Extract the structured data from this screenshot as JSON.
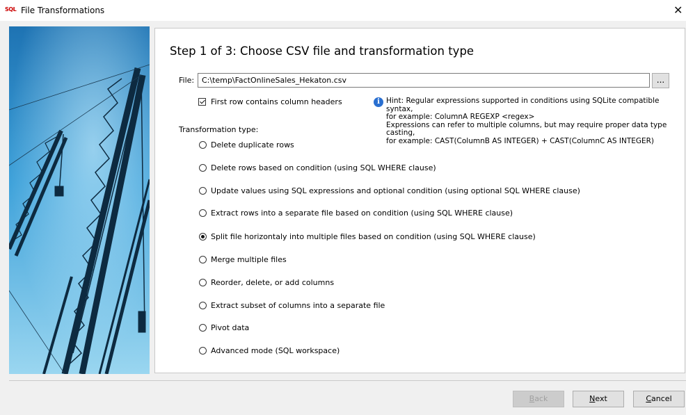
{
  "window": {
    "title": "File Transformations",
    "icon_text": "SQL",
    "close_glyph": "✕"
  },
  "step": {
    "title": "Step 1 of 3:  Choose CSV file and transformation type"
  },
  "file": {
    "label": "File:",
    "value": "C:\\temp\\FactOnlineSales_Hekaton.csv",
    "browse_label": "..."
  },
  "first_row_header": {
    "label": "First row contains column headers",
    "checked": true
  },
  "hint": {
    "line1": "Hint: Regular expressions supported in  conditions using SQLite compatible syntax,",
    "line2": "for example: ColumnA REGEXP <regex>",
    "line3": "Expressions can refer to multiple columns, but may require proper data type casting,",
    "line4": "for example: CAST(ColumnB AS INTEGER) + CAST(ColumnC AS INTEGER)"
  },
  "transformation": {
    "label": "Transformation type:",
    "options": [
      {
        "label": "Delete duplicate rows",
        "checked": false
      },
      {
        "label": "Delete rows based on condition (using SQL WHERE clause)",
        "checked": false
      },
      {
        "label": "Update values using SQL expressions and optional condition (using optional SQL WHERE clause)",
        "checked": false
      },
      {
        "label": "Extract rows into a separate file based on condition (using SQL WHERE clause)",
        "checked": false
      },
      {
        "label": "Split file horizontaly into multiple files based on condition (using SQL WHERE clause)",
        "checked": true
      },
      {
        "label": "Merge multiple files",
        "checked": false
      },
      {
        "label": "Reorder, delete, or add columns",
        "checked": false
      },
      {
        "label": "Extract subset of columns into a separate file",
        "checked": false
      },
      {
        "label": "Pivot data",
        "checked": false
      },
      {
        "label": "Advanced mode (SQL workspace)",
        "checked": false
      }
    ]
  },
  "buttons": {
    "back": {
      "mnemonic": "B",
      "rest": "ack",
      "enabled": false
    },
    "next": {
      "mnemonic": "N",
      "rest": "ext",
      "enabled": true
    },
    "cancel": {
      "mnemonic": "C",
      "rest": "ancel",
      "enabled": true
    }
  },
  "colors": {
    "sky_top": "#1b6aa8",
    "sky_bottom": "#8ed0ee",
    "info_blue": "#2a6fd0"
  }
}
